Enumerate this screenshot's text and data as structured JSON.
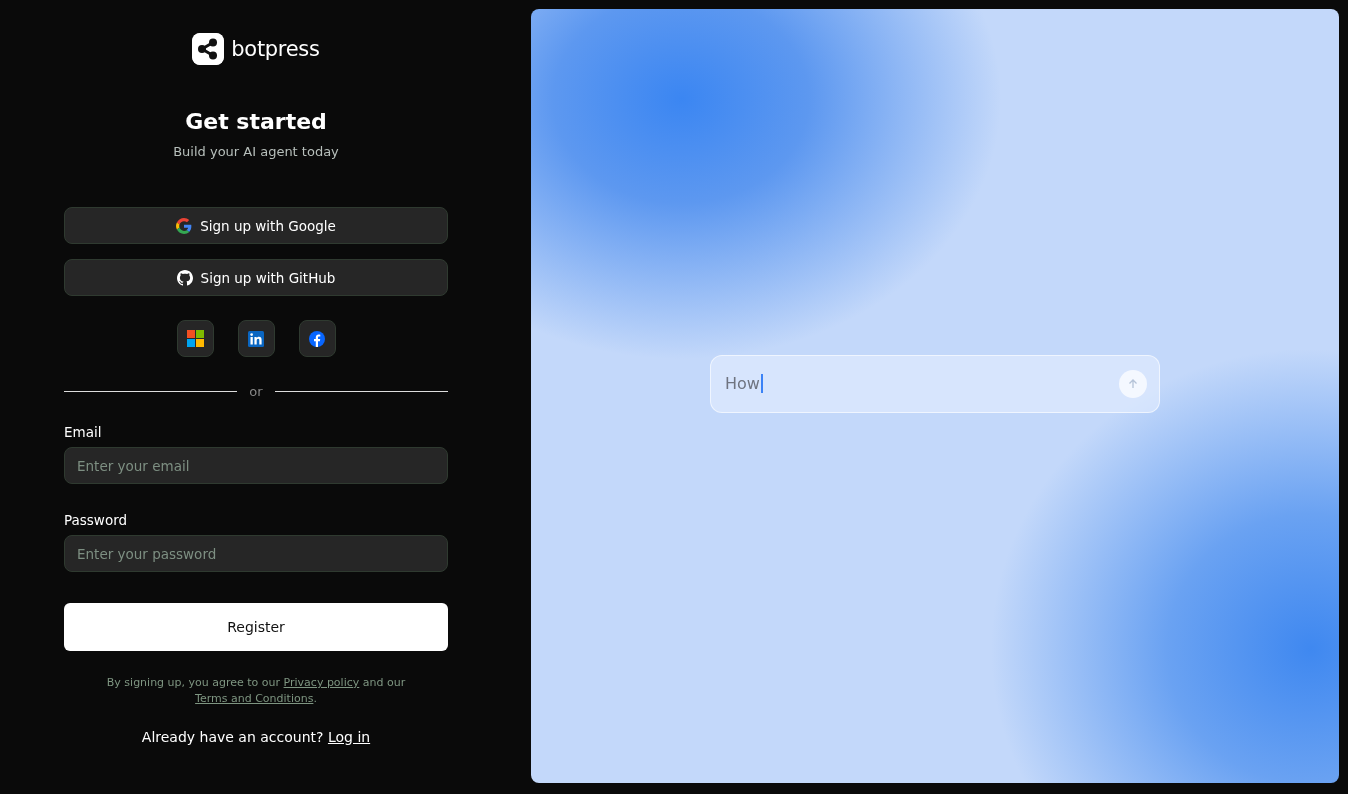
{
  "brand": {
    "name": "botpress"
  },
  "heading": "Get started",
  "subtitle": "Build your AI agent today",
  "oauth_buttons": [
    {
      "kind": "google",
      "label": "Sign up with Google"
    },
    {
      "kind": "github",
      "label": "Sign up with GitHub"
    }
  ],
  "social_buttons": [
    {
      "kind": "microsoft"
    },
    {
      "kind": "linkedin"
    },
    {
      "kind": "facebook"
    }
  ],
  "divider": "or",
  "fields": [
    {
      "label": "Email",
      "placeholder": "Enter your email"
    },
    {
      "label": "Password",
      "placeholder": "Enter your password"
    }
  ],
  "submit": "Register",
  "legal": [
    {
      "kind": "text",
      "text": "By signing up, you agree to our "
    },
    {
      "kind": "link",
      "text": "Privacy policy"
    },
    {
      "kind": "text",
      "text": " and our "
    },
    {
      "kind": "link",
      "text": "Terms and Conditions"
    },
    {
      "kind": "text",
      "text": "."
    }
  ],
  "login_prompt": {
    "text": "Already have an account?",
    "link": "Log in"
  },
  "preview": {
    "prompt_value": "How"
  }
}
